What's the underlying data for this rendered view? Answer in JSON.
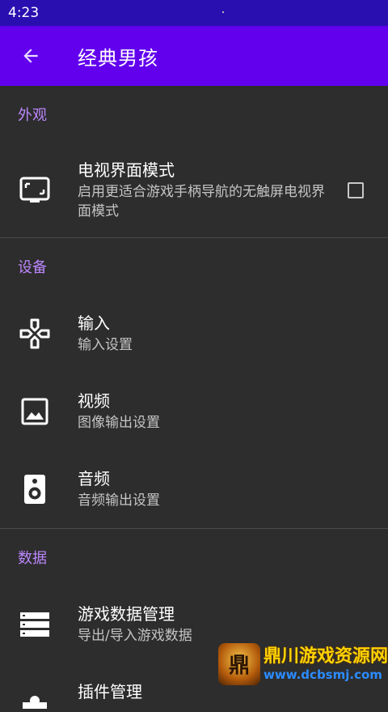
{
  "status_bar": {
    "time": "4:23"
  },
  "app_bar": {
    "title": "经典男孩",
    "back_icon": "arrow-back-icon"
  },
  "sections": {
    "appearance": {
      "header": "外观"
    },
    "device": {
      "header": "设备"
    },
    "data": {
      "header": "数据"
    }
  },
  "items": {
    "tv_mode": {
      "title": "电视界面模式",
      "subtitle": "启用更适合游戏手柄导航的无触屏电视界面模式",
      "icon": "tv-icon",
      "checked": false
    },
    "input": {
      "title": "输入",
      "subtitle": "输入设置",
      "icon": "gamepad-icon"
    },
    "video": {
      "title": "视频",
      "subtitle": "图像输出设置",
      "icon": "image-icon"
    },
    "audio": {
      "title": "音频",
      "subtitle": "音频输出设置",
      "icon": "speaker-icon"
    },
    "game_data": {
      "title": "游戏数据管理",
      "subtitle": "导出/导入游戏数据",
      "icon": "storage-icon"
    },
    "plugins": {
      "title": "插件管理",
      "icon": "plugin-icon"
    }
  },
  "watermark": {
    "logo_text": "鼎",
    "main": "鼎川游戏资源网",
    "sub": "www.dcbsmj.com"
  },
  "colors": {
    "status_bar": "#2a0fb0",
    "app_bar": "#6200ee",
    "accent": "#bb86fc",
    "background": "#2d2d2d"
  }
}
